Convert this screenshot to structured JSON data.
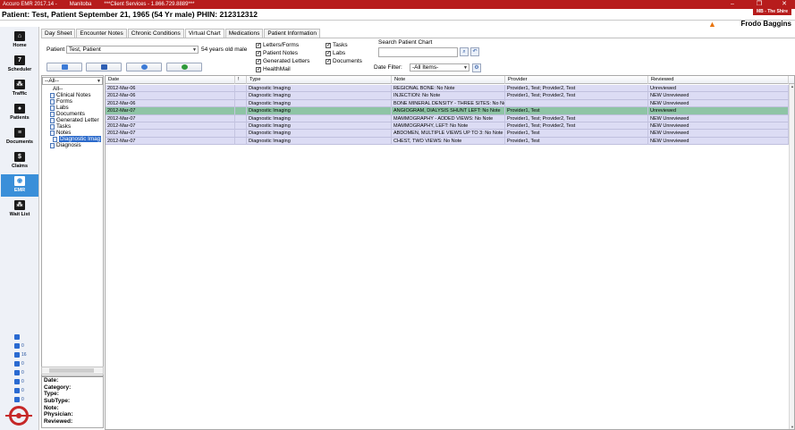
{
  "window": {
    "title": "Accuro EMR 2017.14 -",
    "province": "Manitoba",
    "client_services": "***Client Services - 1.866.729.8889***"
  },
  "patient_bar": {
    "text": "Patient: Test, Patient   September 21, 1965 (54 Yr  male)  PHIN:  212312312",
    "location": "MB - The Shire",
    "user": "Frodo Baggins",
    "warning_icon": "warning-icon"
  },
  "nav": {
    "items": [
      {
        "label": "Home",
        "icon": "home-icon",
        "glyph": "⌂"
      },
      {
        "label": "Scheduler",
        "icon": "calendar-icon",
        "glyph": "7"
      },
      {
        "label": "Traffic",
        "icon": "traffic-icon",
        "glyph": "⁂"
      },
      {
        "label": "Patients",
        "icon": "person-icon",
        "glyph": "●"
      },
      {
        "label": "Documents",
        "icon": "document-icon",
        "glyph": "≡"
      },
      {
        "label": "Claims",
        "icon": "dollar-icon",
        "glyph": "$"
      },
      {
        "label": "EMR",
        "icon": "camera-icon",
        "glyph": "◉"
      },
      {
        "label": "Wait List",
        "icon": "group-icon",
        "glyph": "⁂"
      }
    ],
    "active": "EMR",
    "stats": [
      "",
      "0",
      "16",
      "0",
      "0",
      "0",
      "0",
      "0"
    ]
  },
  "tabs": [
    "Day Sheet",
    "Encounter Notes",
    "Chronic Conditions",
    "Virtual Chart",
    "Medications",
    "Patient Information"
  ],
  "active_tab": "Virtual Chart",
  "toolbar": {
    "patient_label": "Patient",
    "patient_value": "Test, Patient",
    "age_text": "54 years old male",
    "checkboxes_col1": [
      {
        "label": "Letters/Forms",
        "checked": true
      },
      {
        "label": "Patient Notes",
        "checked": true
      },
      {
        "label": "Generated Letters",
        "checked": true
      },
      {
        "label": "HealthMail",
        "checked": true
      }
    ],
    "checkboxes_col2": [
      {
        "label": "Tasks",
        "checked": true
      },
      {
        "label": "Labs",
        "checked": true
      },
      {
        "label": "Documents",
        "checked": true
      }
    ],
    "search_label": "Search Patient Chart",
    "search_value": "",
    "date_filter_label": "Date Filter:",
    "date_filter_value": "-All Items-"
  },
  "tree": {
    "filter": "--All--",
    "nodes": [
      "All--",
      "Clinical Notes",
      "Forms",
      "Labs",
      "Documents",
      "Generated Letter",
      "Tasks",
      "Notes",
      "Diagnostic Imag",
      "Diagnosis"
    ],
    "selected": "Diagnostic Imag"
  },
  "details": [
    "Date:",
    "Category:",
    "Type:",
    "SubType:",
    "Note:",
    "Physician:",
    "Reviewed:"
  ],
  "grid": {
    "headers": [
      "Date",
      "!",
      "Type",
      "Note",
      "Provider",
      "Reviewed"
    ],
    "rows": [
      [
        "2012-Mar-06",
        "",
        "Diagnostic Imaging",
        "REGIONAL BONE: No Note",
        "Provider1, Test; Provider2, Test",
        "Unreviewed"
      ],
      [
        "2012-Mar-06",
        "",
        "Diagnostic Imaging",
        "INJECTION: No Note",
        "Provider1, Test; Provider2, Test",
        "NEW Unreviewed"
      ],
      [
        "2012-Mar-06",
        "",
        "Diagnostic Imaging",
        "BONE MINERAL DENSITY - THREE SITES: No Note",
        "",
        "NEW Unreviewed"
      ],
      [
        "2012-Mar-07",
        "",
        "Diagnostic Imaging",
        "ANGIOGRAM, DIALYSIS SHUNT LEFT: No Note",
        "Provider1, Test",
        "Unreviewed"
      ],
      [
        "2012-Mar-07",
        "",
        "Diagnostic Imaging",
        "MAMMOGRAPHY - ADDED VIEWS: No Note",
        "Provider1, Test; Provider2, Test",
        "NEW Unreviewed"
      ],
      [
        "2012-Mar-07",
        "",
        "Diagnostic Imaging",
        "MAMMOGRAPHY, LEFT: No Note",
        "Provider1, Test; Provider2, Test",
        "NEW Unreviewed"
      ],
      [
        "2012-Mar-07",
        "",
        "Diagnostic Imaging",
        "ABDOMEN, MULTIPLE VIEWS UP TO 3: No Note",
        "Provider1, Test",
        "NEW Unreviewed"
      ],
      [
        "2012-Mar-07",
        "",
        "Diagnostic Imaging",
        "CHEST, TWO VIEWS: No Note",
        "Provider1, Test",
        "NEW Unreviewed"
      ]
    ],
    "selected_row": 3
  }
}
